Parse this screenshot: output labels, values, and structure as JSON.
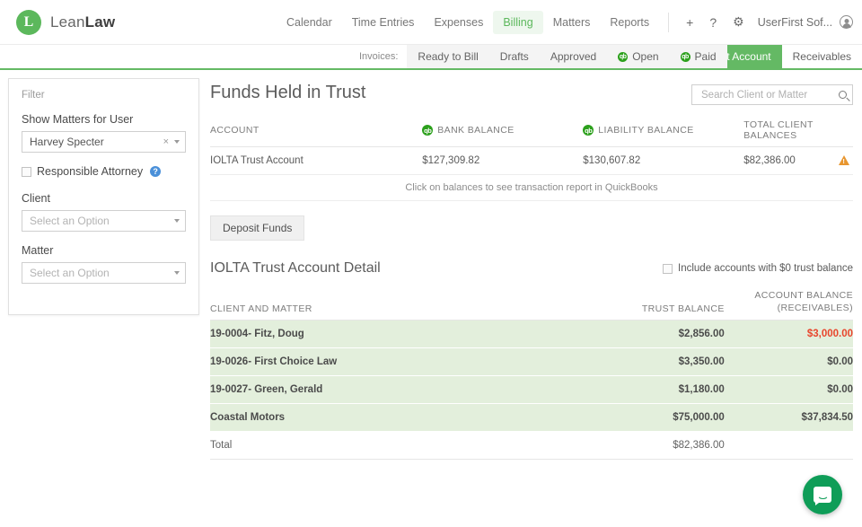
{
  "brand": {
    "mark": "L",
    "name_light": "Lean",
    "name_bold": "Law"
  },
  "topnav": {
    "items": [
      {
        "label": "Calendar",
        "active": false
      },
      {
        "label": "Time Entries",
        "active": false
      },
      {
        "label": "Expenses",
        "active": false
      },
      {
        "label": "Billing",
        "active": true
      },
      {
        "label": "Matters",
        "active": false
      },
      {
        "label": "Reports",
        "active": false
      }
    ],
    "add_icon": "plus-icon",
    "add_label": "+",
    "help_icon": "question-icon",
    "help_label": "?",
    "settings_icon": "gear-icon",
    "settings_label": "⚙",
    "user_label": "UserFirst Sof...",
    "user_icon": "avatar-icon"
  },
  "subnav": {
    "label": "Invoices:",
    "tabs": [
      {
        "label": "Ready to Bill",
        "icon": null,
        "active": false
      },
      {
        "label": "Drafts",
        "icon": null,
        "active": false
      },
      {
        "label": "Approved",
        "icon": null,
        "active": false
      },
      {
        "label": "Open",
        "icon": "quickbooks-icon",
        "active": false
      },
      {
        "label": "Paid",
        "icon": "quickbooks-icon",
        "active": false
      }
    ],
    "right_tabs": [
      {
        "label": "Trust Account",
        "active": true
      },
      {
        "label": "Receivables",
        "active": false
      }
    ],
    "qb_glyph": "qb"
  },
  "sidebar": {
    "title": "Filter",
    "user_field": {
      "label": "Show Matters for User",
      "value": "Harvey Specter",
      "clear_icon": "clear-icon",
      "clear_glyph": "×"
    },
    "responsible_attorney": {
      "label": "Responsible Attorney",
      "checked": false,
      "help_glyph": "?"
    },
    "client_field": {
      "label": "Client",
      "placeholder": "Select an Option",
      "value": ""
    },
    "matter_field": {
      "label": "Matter",
      "placeholder": "Select an Option",
      "value": ""
    }
  },
  "main": {
    "page_title": "Funds Held in Trust",
    "search": {
      "placeholder": "Search Client or Matter",
      "value": "",
      "icon": "search-icon"
    },
    "summary": {
      "headers": {
        "account": "ACCOUNT",
        "bank_balance": "BANK BALANCE",
        "liability_balance": "LIABILITY BALANCE",
        "total_client_balances": "TOTAL CLIENT BALANCES"
      },
      "row": {
        "account": "IOLTA Trust Account",
        "bank_balance": "$127,309.82",
        "liability_balance": "$130,607.82",
        "total_client_balances": "$82,386.00",
        "warning_icon": "warning-triangle-icon"
      },
      "note": "Click on balances to see transaction report in QuickBooks"
    },
    "deposit_button": "Deposit Funds",
    "detail": {
      "title": "IOLTA Trust Account Detail",
      "include_zero": {
        "label": "Include accounts with $0 trust balance",
        "checked": false
      },
      "headers": {
        "client_and_matter": "CLIENT AND MATTER",
        "trust_balance": "TRUST BALANCE",
        "account_balance_line1": "ACCOUNT BALANCE",
        "account_balance_line2": "(RECEIVABLES)"
      },
      "rows": [
        {
          "client": "19-0004- Fitz, Doug",
          "trust": "$2,856.00",
          "receivable": "$3,000.00",
          "receivable_negative": true
        },
        {
          "client": "19-0026- First Choice Law",
          "trust": "$3,350.00",
          "receivable": "$0.00",
          "receivable_negative": false
        },
        {
          "client": "19-0027- Green, Gerald",
          "trust": "$1,180.00",
          "receivable": "$0.00",
          "receivable_negative": false
        },
        {
          "client": "Coastal Motors",
          "trust": "$75,000.00",
          "receivable": "$37,834.50",
          "receivable_negative": false
        }
      ],
      "total": {
        "label": "Total",
        "trust": "$82,386.00",
        "receivable": ""
      }
    }
  },
  "chat": {
    "icon": "chat-bubble-icon",
    "label": ""
  },
  "colors": {
    "brand_green": "#5cb85c",
    "tab_green": "#64b964",
    "quickbooks_green": "#2ca01c",
    "row_green": "#e3efdc",
    "alert_red": "#e8452c",
    "warning_orange": "#e8962f",
    "chat_green": "#0f9d58"
  }
}
